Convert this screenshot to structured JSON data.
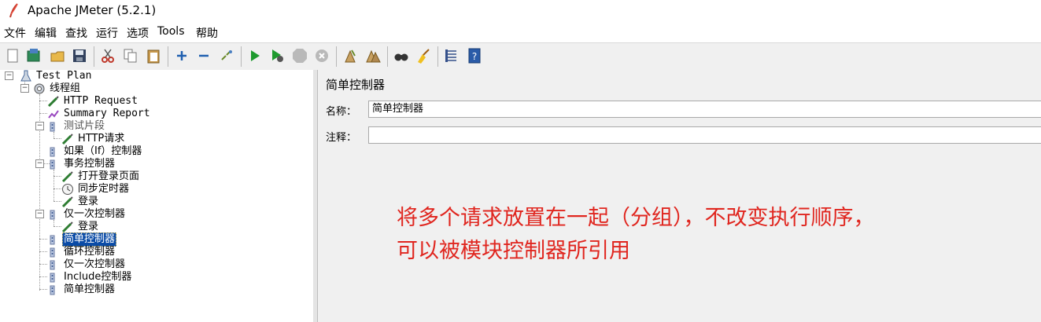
{
  "window": {
    "title": "Apache JMeter (5.2.1)"
  },
  "menubar": [
    "文件",
    "编辑",
    "查找",
    "运行",
    "选项",
    "Tools",
    "帮助"
  ],
  "toolbar": [
    "new-icon",
    "templates-icon",
    "open-icon",
    "save-icon",
    "cut-icon",
    "copy-icon",
    "paste-icon",
    "expand-icon",
    "collapse-icon",
    "toggle-icon",
    "start-icon",
    "start-no-pause-icon",
    "stop-icon",
    "shutdown-icon",
    "clear-icon",
    "clear-all-icon",
    "search-icon",
    "reset-search-icon",
    "function-helper-icon",
    "help-icon"
  ],
  "tree": [
    {
      "label": "Test Plan",
      "mono": true
    },
    {
      "label": "线程组"
    },
    {
      "label": "HTTP Request",
      "mono": true
    },
    {
      "label": "Summary Report",
      "mono": true
    },
    {
      "label": "测试片段",
      "dim": true
    },
    {
      "label": "HTTP请求"
    },
    {
      "label": "如果（If）控制器"
    },
    {
      "label": "事务控制器"
    },
    {
      "label": "打开登录页面"
    },
    {
      "label": "同步定时器"
    },
    {
      "label": "登录"
    },
    {
      "label": "仅一次控制器"
    },
    {
      "label": "登录"
    },
    {
      "label": "简单控制器",
      "selected": true
    },
    {
      "label": "循环控制器"
    },
    {
      "label": "仅一次控制器"
    },
    {
      "label": "Include控制器"
    },
    {
      "label": "简单控制器"
    }
  ],
  "panel": {
    "title": "简单控制器",
    "name_label": "名称：",
    "name_value": "简单控制器",
    "comment_label": "注释：",
    "comment_value": ""
  },
  "annotation": {
    "line1": "将多个请求放置在一起（分组），不改变执行顺序，",
    "line2": "可以被模块控制器所引用"
  },
  "colors": {
    "annotation": "#e0261f",
    "selection": "#0a4ba6"
  }
}
